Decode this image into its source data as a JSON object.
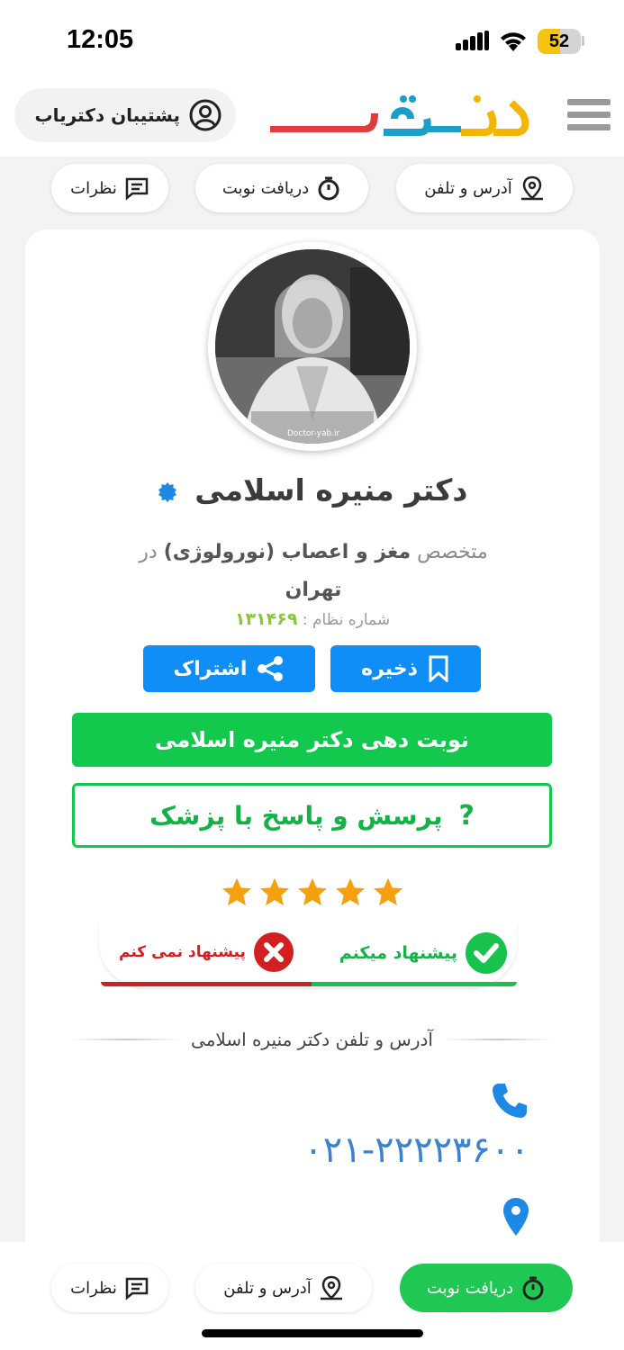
{
  "status_bar": {
    "time": "12:05",
    "battery": "52",
    "battery_level": 0.52
  },
  "header": {
    "support_label": "پشتیبان دکتریاب",
    "logo_text": "دکتریاب"
  },
  "top_tabs": {
    "address": "آدرس و تلفن",
    "appointment": "دریافت نوبت",
    "reviews": "نظرات"
  },
  "doctor": {
    "name": "دکتر منیره اسلامی",
    "spec_prefix": "متخصص",
    "specialty": "مغز و اعصاب (نورولوژی)",
    "in_word": "در",
    "city": "تهران",
    "reg_label": "شماره نظام :",
    "reg_number": "۱۳۱۴۶۹",
    "photo_watermark": "Doctor-yab.ir"
  },
  "actions": {
    "save": "ذخیره",
    "share": "اشتراک",
    "book": "نوبت دهی دکتر منیره اسلامی",
    "ask": "پرسش و پاسخ با پزشک",
    "ask_mark": "?"
  },
  "rating": {
    "stars": 5,
    "max": 5
  },
  "recommend": {
    "yes": "پیشنهاد میکنم",
    "no": "پیشنهاد نمی کنم"
  },
  "contact": {
    "section_title": "آدرس و تلفن دکتر منیره اسلامی",
    "phone": "۰۲۱-۲۲۲۲۳۶۰۰"
  },
  "bottom_tabs": {
    "appointment": "دریافت نوبت",
    "address": "آدرس و تلفن",
    "reviews": "نظرات"
  },
  "colors": {
    "green": "#13c94d",
    "blue": "#0f8ef7",
    "red": "#d21f1f",
    "star": "#f5a10f"
  }
}
